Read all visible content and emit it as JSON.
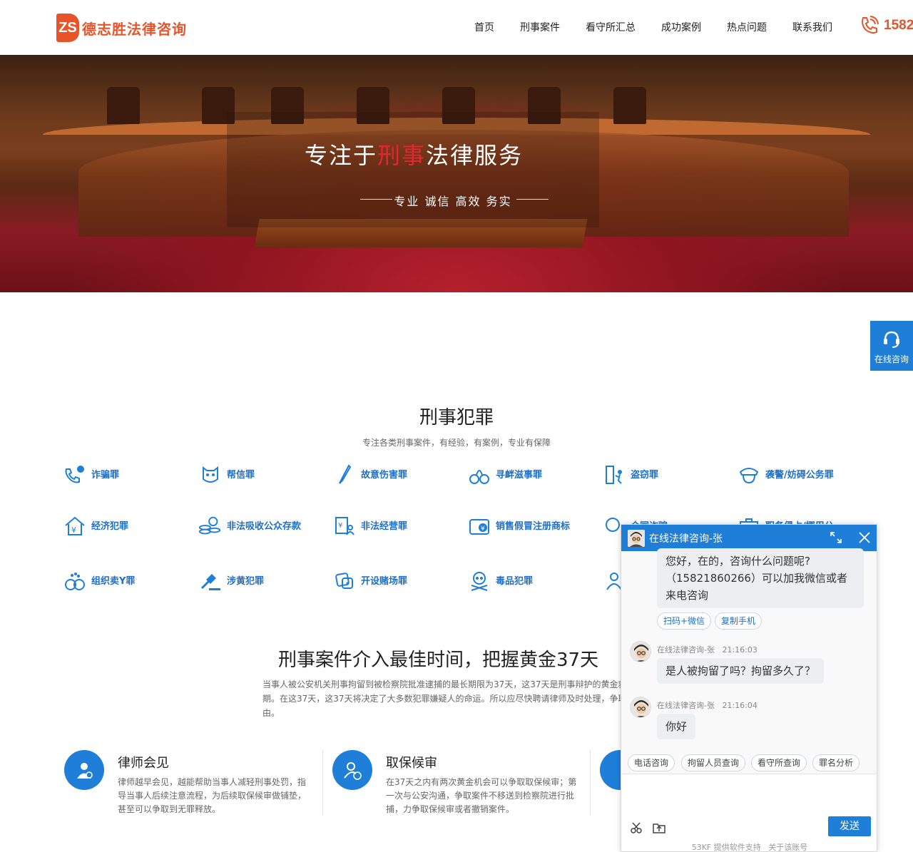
{
  "header": {
    "logo_mark": "ZS",
    "logo_text": "德志胜法律咨询",
    "nav": [
      "首页",
      "刑事案件",
      "看守所汇总",
      "成功案例",
      "热点问题",
      "联系我们"
    ],
    "phone": "1582"
  },
  "banner": {
    "title_pre": "专注于",
    "title_hl": "刑事",
    "title_post": "法律服务",
    "subtitle": "专业  诚信  高效  务实"
  },
  "float_button": {
    "label": "在线咨询"
  },
  "crime_section": {
    "title": "刑事犯罪",
    "subtitle": "专注各类刑事案件，有经验，有案例，专业有保障",
    "items": [
      "诈骗罪",
      "帮信罪",
      "故意伤害罪",
      "寻衅滋事罪",
      "盗窃罪",
      "袭警/妨碍公务罪",
      "经济犯罪",
      "非法吸收公众存款",
      "非法经营罪",
      "销售假冒注册商标",
      "合同诈骗",
      "职务侵占/挪用公",
      "组织卖Y罪",
      "涉黄犯罪",
      "开设赌场罪",
      "毒品犯罪",
      ""
    ]
  },
  "golden": {
    "title": "刑事案件介入最佳时间，把握黄金37天",
    "text": "当事人被公安机关刑事拘留到被检察院批准逮捕的最长期限为37天，这37天是刑事辩护的黄金救援期。在这37天，这37天将决定了大多数犯罪嫌疑人的命运。所以应尽快聘请律师及时处理，争取自由。"
  },
  "services": [
    {
      "title": "律师会见",
      "desc": "律师越早会见，越能帮助当事人减轻刑事处罚，指导当事人后续注意流程，为后续取保候审做铺垫，甚至可以争取到无罪释放。"
    },
    {
      "title": "取保候审",
      "desc": "在37天之内有两次黄金机会可以争取取保候审；第一次与公安沟通，争取案件不移送到检察院进行批捕，力争取保候审或者撤销案件。"
    }
  ],
  "chat": {
    "title": "在线法律咨询-张",
    "welcome": "您好，在的，咨询什么问题呢?（15821860266）可以加我微信或者来电咨询",
    "chips_top": [
      "扫码+微信",
      "复制手机"
    ],
    "messages": [
      {
        "sender": "在线法律咨询-张",
        "time": "21:16:03",
        "text": "是人被拘留了吗？拘留多久了？"
      },
      {
        "sender": "在线法律咨询-张",
        "time": "21:16:04",
        "text": "你好"
      }
    ],
    "quick_replies": [
      "电话咨询",
      "拘留人员查询",
      "看守所查询",
      "罪名分析"
    ],
    "send_label": "发送",
    "footer_left": "53KF 提供软件支持",
    "footer_right": "关于该账号"
  }
}
